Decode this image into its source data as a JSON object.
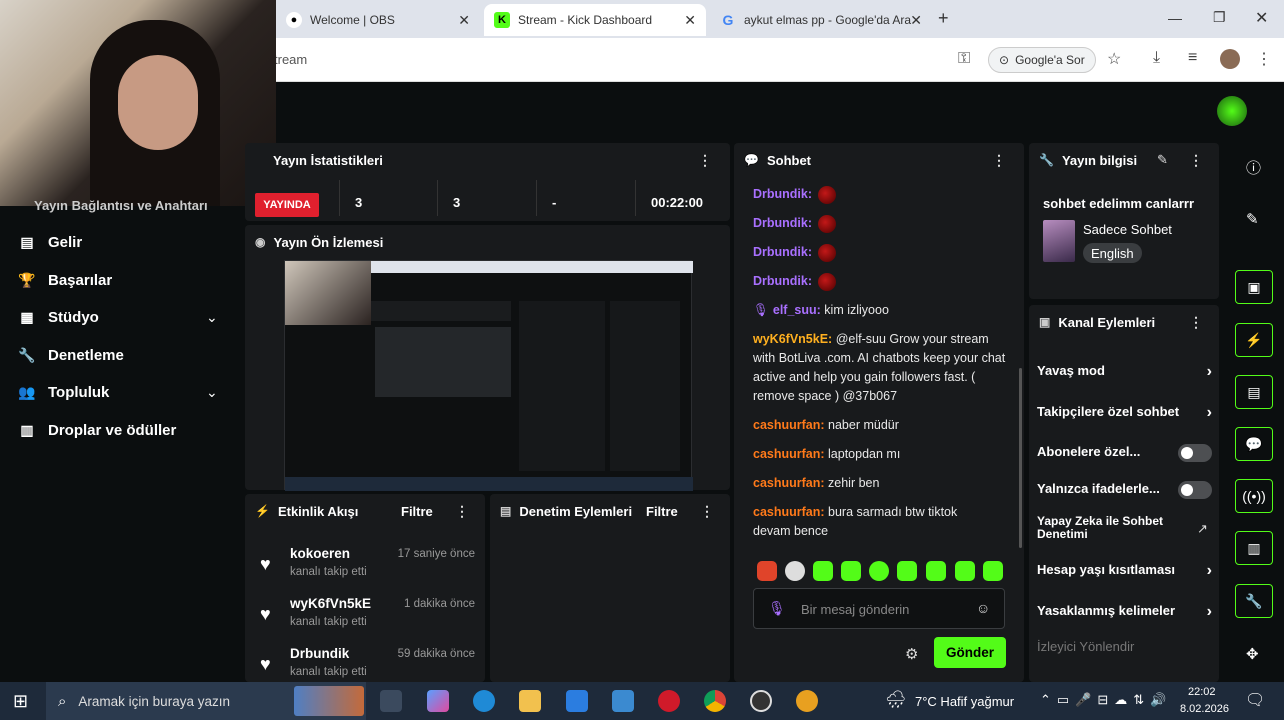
{
  "browser": {
    "tabs": [
      {
        "label": "Welcome | OBS",
        "icon": "obs-icon"
      },
      {
        "label": "Stream - Kick Dashboard",
        "icon": "kick-icon"
      },
      {
        "label": "aykut elmas pp - Google'da Ara",
        "icon": "google-icon"
      }
    ],
    "url": "tream",
    "google_chip": "Google'a Sor"
  },
  "sidebar": {
    "items": [
      {
        "label": "Yayın Bağlantısı ve Anahtarı"
      },
      {
        "label": "Gelir"
      },
      {
        "label": "Başarılar"
      },
      {
        "label": "Stüdyo"
      },
      {
        "label": "Denetleme"
      },
      {
        "label": "Topluluk"
      },
      {
        "label": "Droplar ve ödüller"
      }
    ]
  },
  "stats": {
    "title": "Yayın İstatistikleri",
    "live_badge": "YAYINDA",
    "viewers": "3",
    "followers": "3",
    "subs": "-",
    "duration": "00:22:00"
  },
  "preview": {
    "title": "Yayın Ön İzlemesi"
  },
  "events": {
    "title": "Etkinlik Akışı",
    "filter": "Filtre",
    "items": [
      {
        "name": "kokoeren",
        "sub": "kanalı takip etti",
        "time": "17 saniye önce"
      },
      {
        "name": "wyK6fVn5kE",
        "sub": "kanalı takip etti",
        "time": "1 dakika önce"
      },
      {
        "name": "Drbundik",
        "sub": "kanalı takip etti",
        "time": "59 dakika önce"
      }
    ]
  },
  "mod_actions": {
    "title": "Denetim Eylemleri",
    "filter": "Filtre"
  },
  "chat": {
    "title": "Sohbet",
    "messages": [
      {
        "user": "Drbundik:",
        "text": ""
      },
      {
        "user": "Drbundik:",
        "text": ""
      },
      {
        "user": "Drbundik:",
        "text": ""
      },
      {
        "user": "Drbundik:",
        "text": ""
      },
      {
        "user": "elf_suu:",
        "text": "kim izliyooo"
      },
      {
        "user": "wyK6fVn5kE:",
        "text": "@elf-suu Grow your stream with BotLiva .com. AI chatbots keep your chat active and help you gain followers fast. ( remove space ) @37b067"
      },
      {
        "user": "cashuurfan:",
        "text": "naber müdür"
      },
      {
        "user": "cashuurfan:",
        "text": "laptopdan mı"
      },
      {
        "user": "cashuurfan:",
        "text": "zehir ben"
      },
      {
        "user": "cashuurfan:",
        "text": "bura sarmadı btw tiktok devam bence"
      }
    ],
    "placeholder": "Bir mesaj gönderin",
    "send": "Gönder",
    "colors": {
      "drbundik": "#a970ff",
      "elf": "#a970ff",
      "wyk": "#ffb020",
      "cash": "#ff7a1a"
    }
  },
  "stream_info": {
    "title": "Yayın bilgisi",
    "stream_title": "sohbet edelimm canlarrr",
    "category": "Sadece Sohbet",
    "language": "English"
  },
  "channel_actions": {
    "title": "Kanal Eylemleri",
    "items": [
      "Yavaş mod",
      "Takipçilere özel sohbet",
      "Abonelere özel...",
      "Yalnızca ifadelerle...",
      "Yapay Zeka ile Sohbet Denetimi",
      "Hesap yaşı kısıtlaması",
      "Yasaklanmış kelimeler",
      "İzleyici Yönlendir"
    ]
  },
  "taskbar": {
    "search": "Aramak için buraya yazın",
    "weather": "7°C  Hafif yağmur",
    "time": "22:02",
    "date": "8.02.2026"
  },
  "accent": "#53fc18"
}
